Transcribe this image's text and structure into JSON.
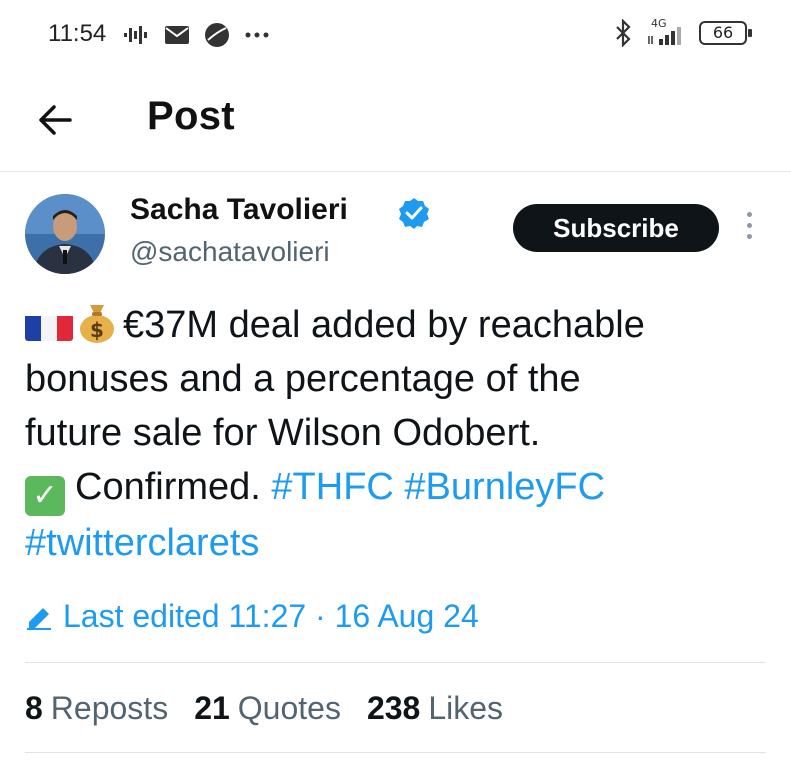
{
  "status_bar": {
    "time": "11:54",
    "network": "4G",
    "battery": "66"
  },
  "header": {
    "title": "Post"
  },
  "post": {
    "author_name": "Sacha Tavolieri",
    "author_handle": "@sachatavolieri",
    "subscribe_label": "Subscribe",
    "text_line1": "€37M deal added by reachable",
    "text_line2": "bonuses and a percentage of the",
    "text_line3": "future sale for Wilson Odobert.",
    "text_confirmed": "Confirmed.",
    "hashtags": [
      "#THFC",
      "#BurnleyFC",
      "#twitterclarets"
    ],
    "edited_label": "Last edited 11:27 · 16 Aug 24"
  },
  "stats": {
    "reposts_count": "8",
    "reposts_label": "Reposts",
    "quotes_count": "21",
    "quotes_label": "Quotes",
    "likes_count": "238",
    "likes_label": "Likes"
  },
  "colors": {
    "accent": "#1d9bf0",
    "text": "#0f1419",
    "secondary": "#536471"
  }
}
